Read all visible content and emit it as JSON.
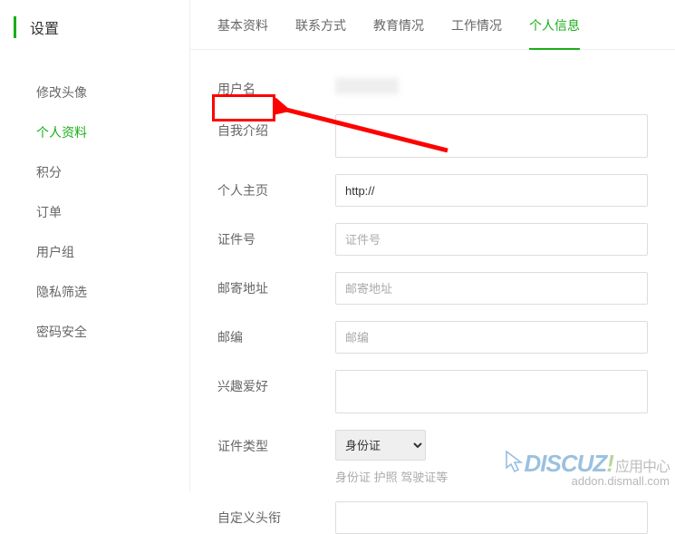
{
  "sidebar": {
    "header": "设置",
    "items": [
      {
        "label": "修改头像"
      },
      {
        "label": "个人资料"
      },
      {
        "label": "积分"
      },
      {
        "label": "订单"
      },
      {
        "label": "用户组"
      },
      {
        "label": "隐私筛选"
      },
      {
        "label": "密码安全"
      }
    ],
    "activeIndex": 1
  },
  "tabs": {
    "items": [
      {
        "label": "基本资料"
      },
      {
        "label": "联系方式"
      },
      {
        "label": "教育情况"
      },
      {
        "label": "工作情况"
      },
      {
        "label": "个人信息"
      }
    ],
    "activeIndex": 4
  },
  "form": {
    "username_label": "用户名",
    "bio_label": "自我介绍",
    "homepage_label": "个人主页",
    "homepage_value": "http://",
    "idnum_label": "证件号",
    "idnum_placeholder": "证件号",
    "address_label": "邮寄地址",
    "address_placeholder": "邮寄地址",
    "zip_label": "邮编",
    "zip_placeholder": "邮编",
    "hobby_label": "兴趣爱好",
    "idtype_label": "证件类型",
    "idtype_selected": "身份证",
    "idtype_hint": "身份证 护照 驾驶证等",
    "custom_title_label": "自定义头衔"
  },
  "watermark": {
    "brand": "DISCUZ",
    "excl": "!",
    "sub": "应用中心",
    "url": "addon.dismall.com"
  }
}
